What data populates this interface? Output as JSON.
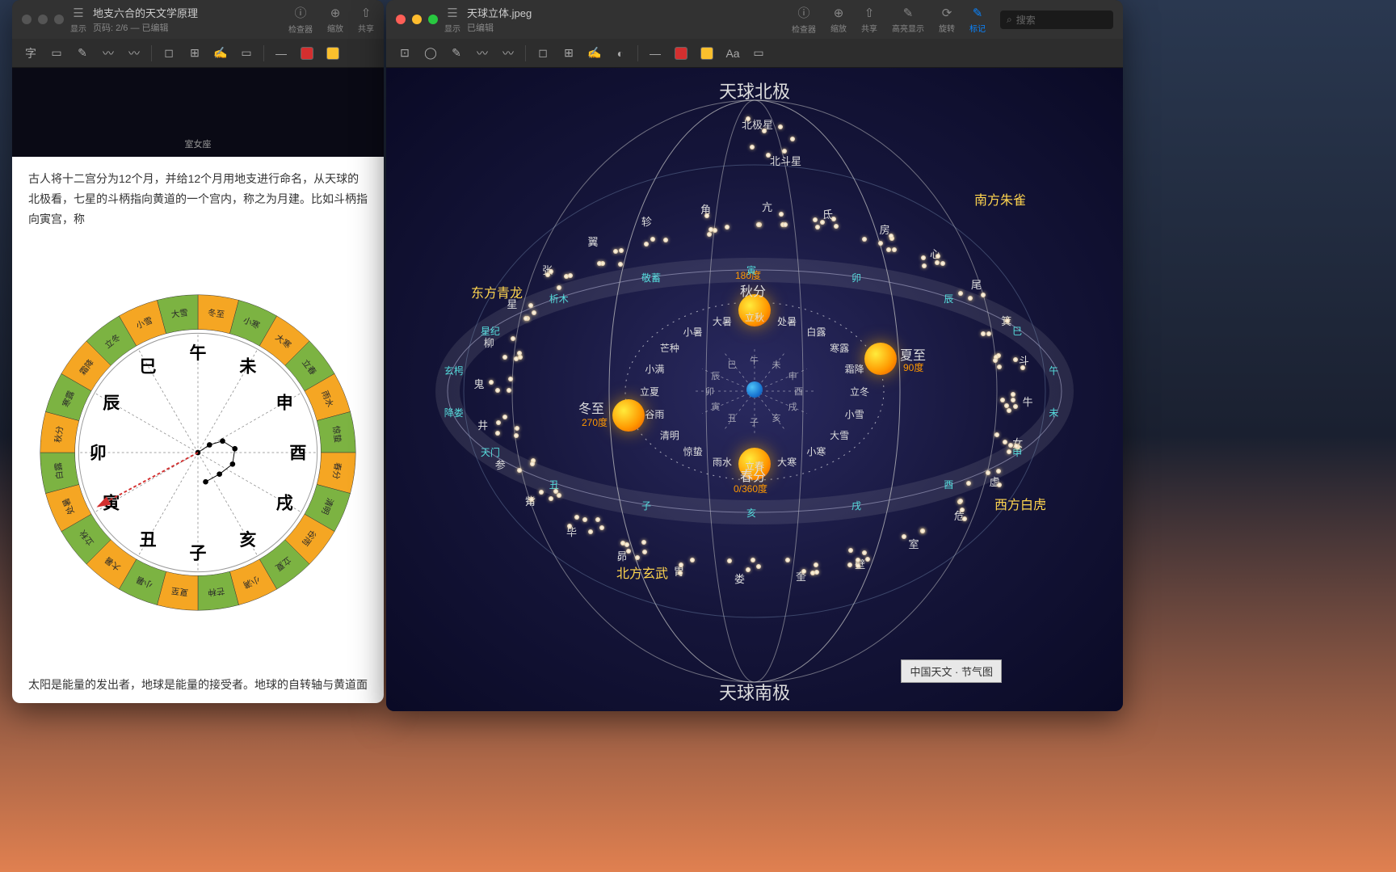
{
  "window1": {
    "title": "地支六合的天文学原理",
    "subtitle": "页码: 2/6 — 已编辑",
    "sublabel": "显示",
    "toolbar": {
      "inspector": "检查器",
      "zoom": "缩放",
      "share": "共享"
    },
    "paragraph1": "古人将十二宫分为12个月，并给12个月用地支进行命名，从天球的北极看，七星的斗柄指向黄道的一个宫内，称之为月建。比如斗柄指向寅宫，称",
    "paragraph2": "太阳是能量的发出者，地球是能量的接受者。地球的自转轴与黄道面"
  },
  "window2": {
    "title": "天球立体.jpeg",
    "subtitle": "已编辑",
    "sublabel": "显示",
    "toolbar": {
      "inspector": "检查器",
      "zoom": "缩放",
      "share": "共享",
      "highlight": "高亮显示",
      "rotate": "旋转",
      "mark": "标记"
    },
    "search_placeholder": "搜索"
  },
  "chart_data": {
    "type": "diagram",
    "zodiac_wheel": {
      "center_branches": [
        "子",
        "丑",
        "寅",
        "卯",
        "辰",
        "巳",
        "午",
        "未",
        "申",
        "酉",
        "戌",
        "亥"
      ],
      "outer_solar_terms": [
        "冬至",
        "小寒",
        "大寒",
        "立春",
        "雨水",
        "惊蛰",
        "春分",
        "清明",
        "谷雨",
        "立夏",
        "小满",
        "芒种",
        "夏至",
        "小暑",
        "大暑",
        "立秋",
        "处暑",
        "白露",
        "秋分",
        "寒露",
        "霜降",
        "立冬",
        "小雪",
        "大雪"
      ],
      "pointer_direction": "卯",
      "colors": {
        "jie": "#f5a623",
        "zhong": "#7cb342"
      }
    },
    "celestial_sphere": {
      "north_pole": "天球北极",
      "south_pole": "天球南极",
      "polaris": "北极星",
      "beidou": "北斗星",
      "directions": {
        "east": "东方青龙",
        "south": "南方朱雀",
        "west": "西方白虎",
        "north": "北方玄武"
      },
      "solstices_equinoxes": [
        {
          "name": "春分",
          "deg": "0/360度",
          "pos": "bottom"
        },
        {
          "name": "夏至",
          "deg": "90度",
          "pos": "right"
        },
        {
          "name": "秋分",
          "deg": "180度",
          "pos": "top"
        },
        {
          "name": "冬至",
          "deg": "270度",
          "pos": "left"
        }
      ],
      "solar_terms_inner": [
        "立春",
        "雨水",
        "惊蛰",
        "清明",
        "谷雨",
        "立夏",
        "小满",
        "芒种",
        "小暑",
        "大暑",
        "立秋",
        "处暑",
        "白露",
        "寒露",
        "霜降",
        "立冬",
        "小雪",
        "大雪",
        "小寒",
        "大寒"
      ],
      "branches_inner": [
        "子",
        "丑",
        "寅",
        "卯",
        "辰",
        "巳",
        "午",
        "未",
        "申",
        "酉",
        "戌",
        "亥"
      ],
      "lunar_mansions": [
        "角",
        "亢",
        "氐",
        "房",
        "心",
        "尾",
        "箕",
        "斗",
        "牛",
        "女",
        "虚",
        "危",
        "室",
        "壁",
        "奎",
        "娄",
        "胃",
        "昴",
        "毕",
        "觜",
        "参",
        "井",
        "鬼",
        "柳",
        "星",
        "张",
        "翼",
        "轸"
      ],
      "ring_marks": [
        "寅",
        "卯",
        "辰",
        "巳",
        "午",
        "未",
        "申",
        "酉",
        "戌",
        "亥",
        "子",
        "丑",
        "天门",
        "降娄",
        "玄枵",
        "星纪",
        "析木",
        "敬蓄"
      ],
      "caption": "中国天文 · 节气图"
    }
  }
}
